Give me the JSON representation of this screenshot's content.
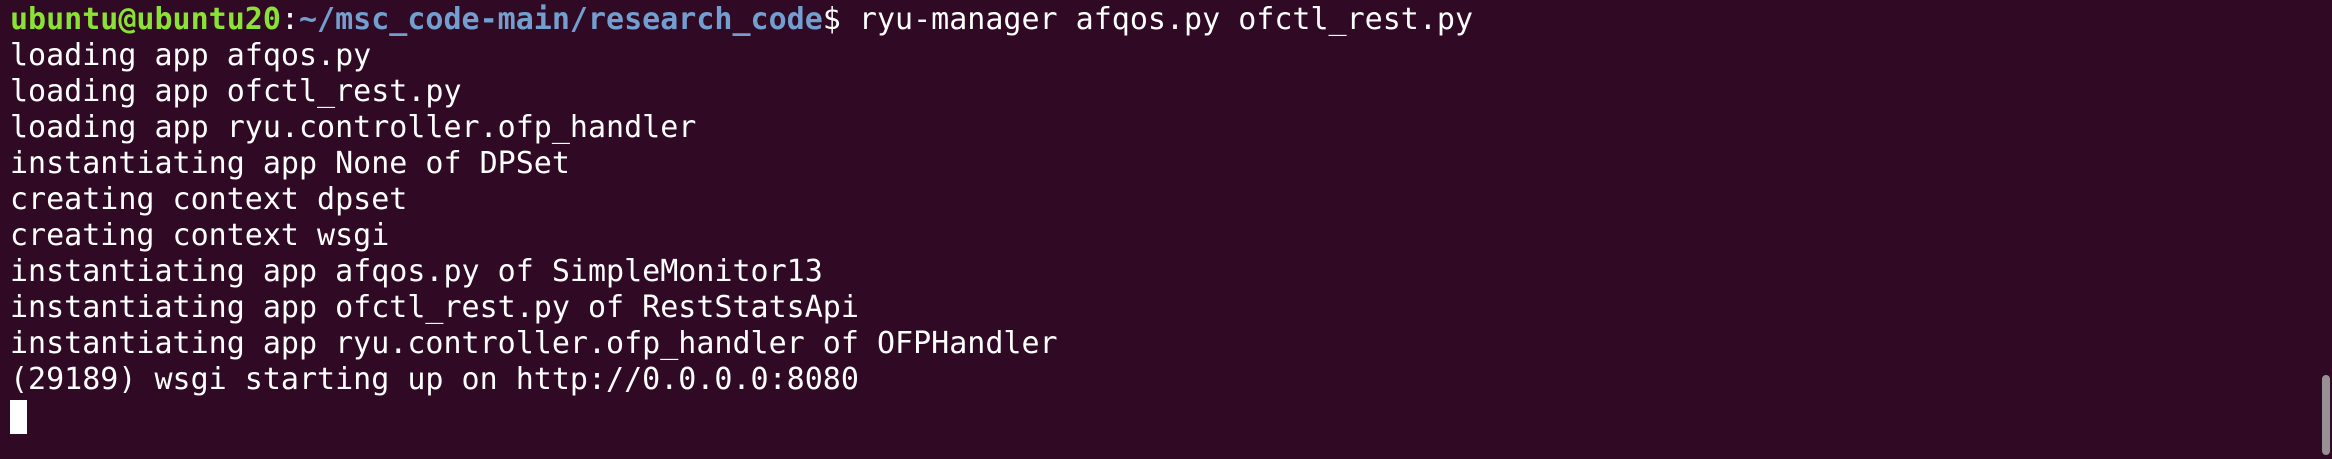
{
  "prompt": {
    "user_host": "ubuntu@ubuntu20",
    "colon": ":",
    "path": "~/msc_code-main/research_code",
    "symbol": "$",
    "command": " ryu-manager afqos.py ofctl_rest.py"
  },
  "output_lines": [
    "loading app afqos.py",
    "loading app ofctl_rest.py",
    "loading app ryu.controller.ofp_handler",
    "instantiating app None of DPSet",
    "creating context dpset",
    "creating context wsgi",
    "instantiating app afqos.py of SimpleMonitor13",
    "instantiating app ofctl_rest.py of RestStatsApi",
    "instantiating app ryu.controller.ofp_handler of OFPHandler",
    "(29189) wsgi starting up on http://0.0.0.0:8080"
  ],
  "colors": {
    "background": "#300a24",
    "foreground": "#ffffff",
    "user_host": "#8ae234",
    "path": "#729fcf"
  }
}
